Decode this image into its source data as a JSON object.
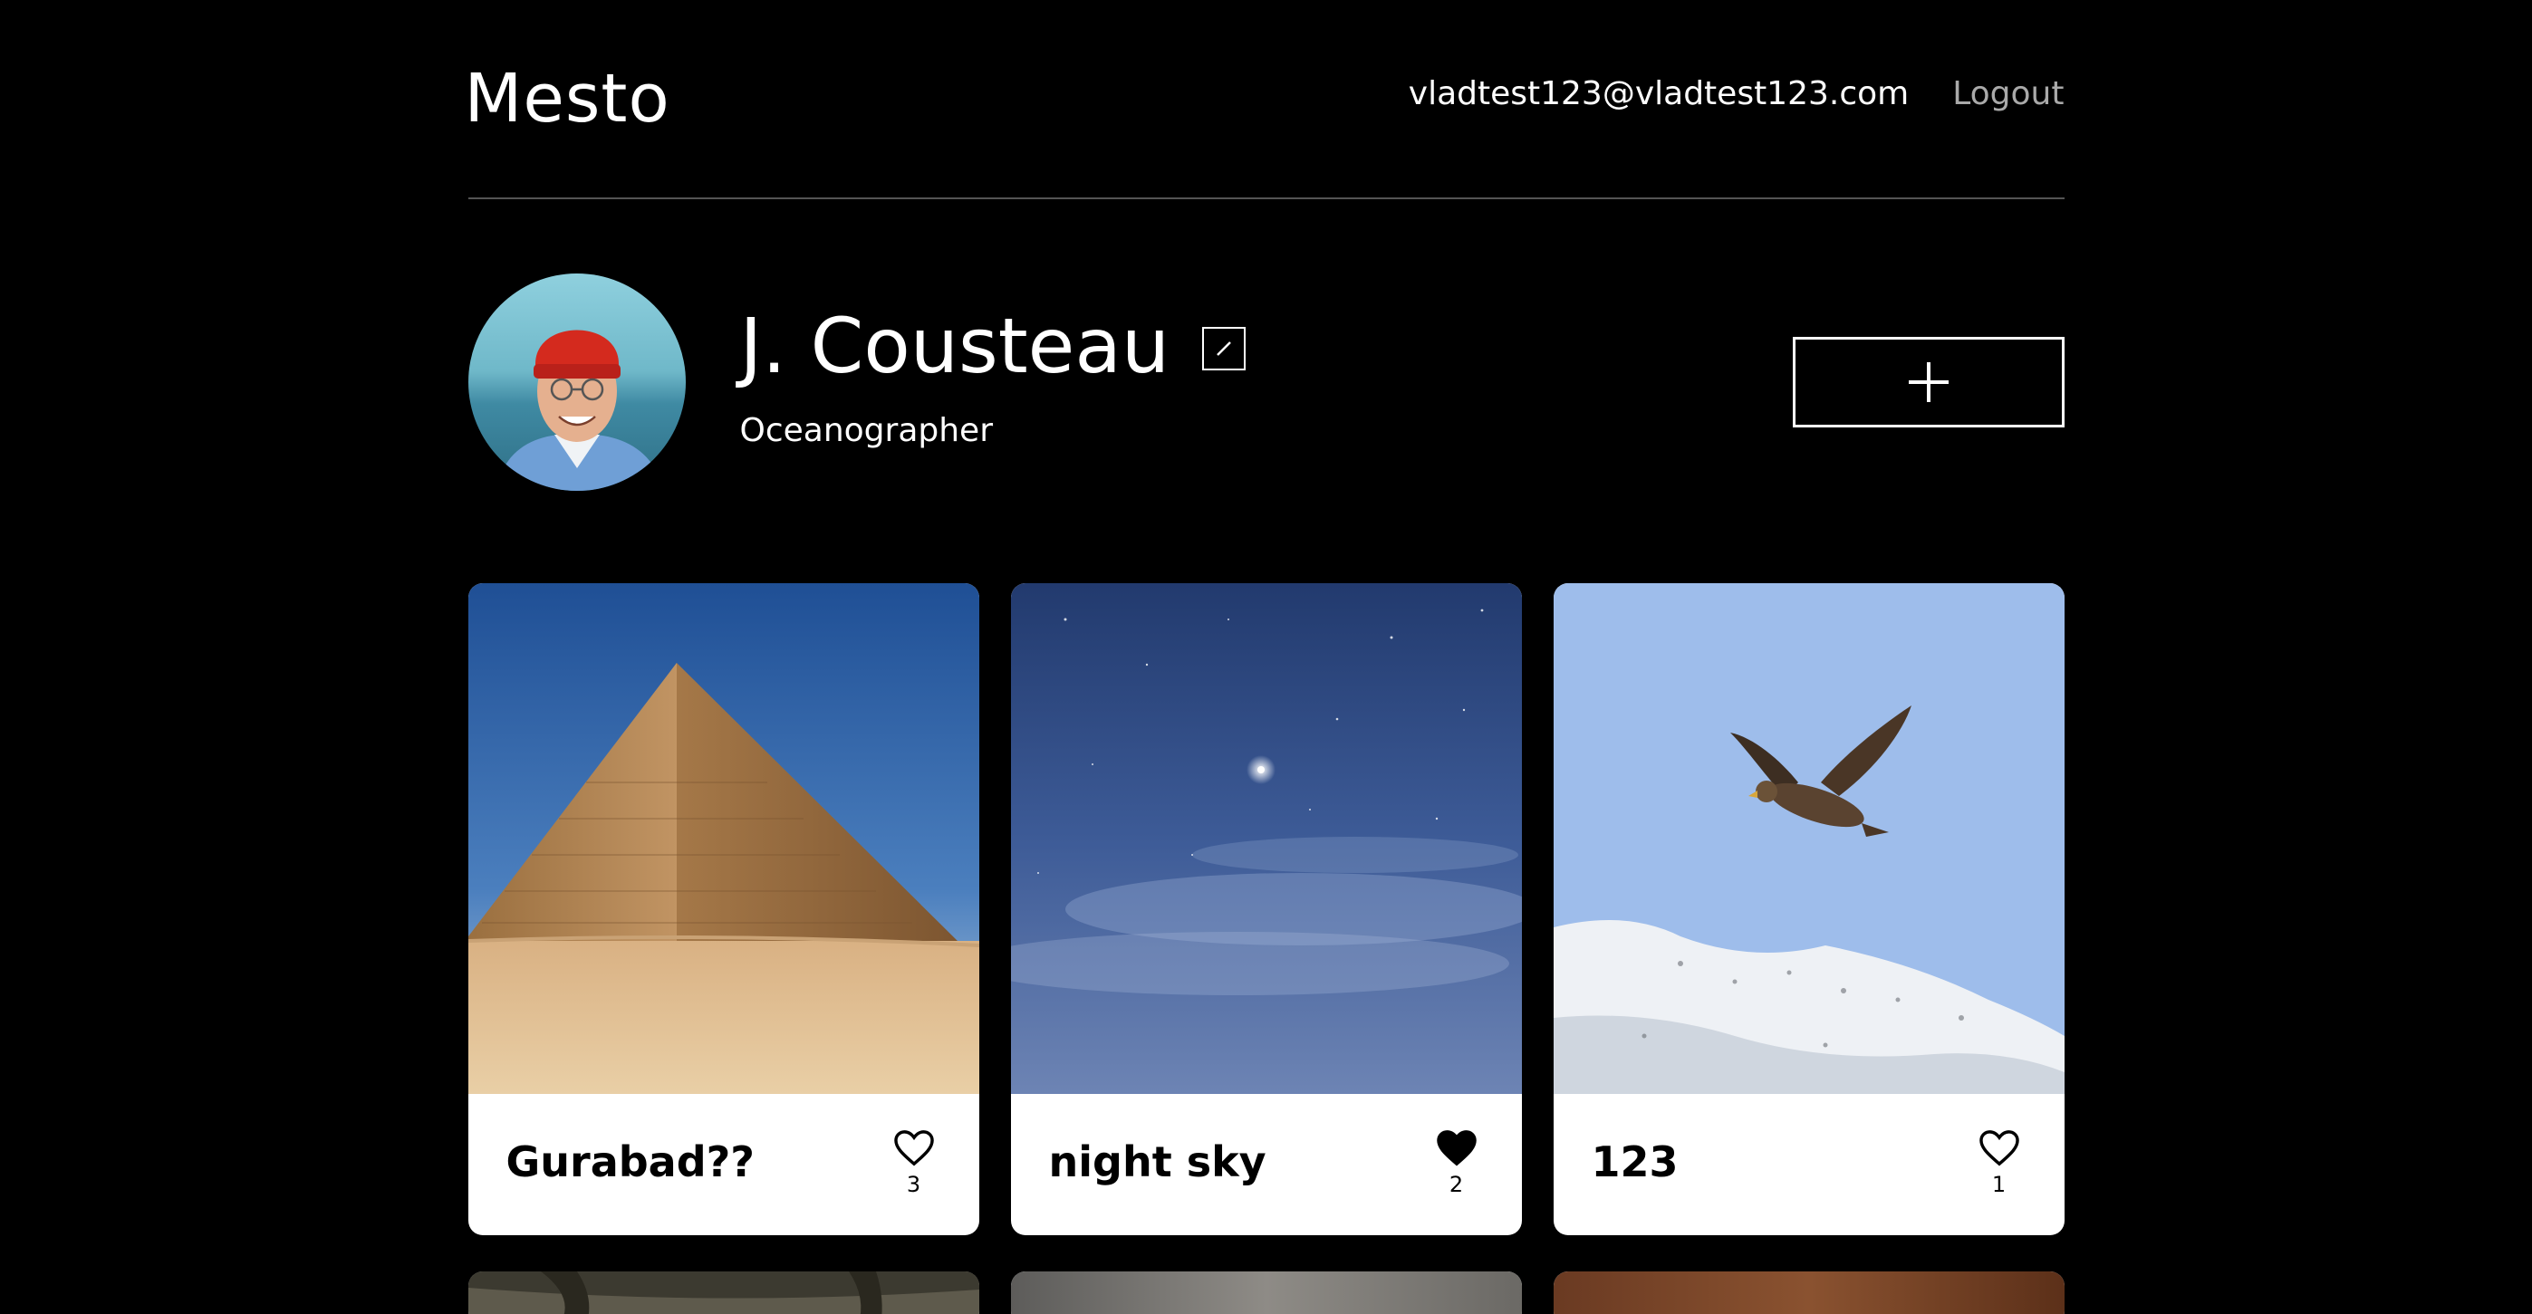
{
  "header": {
    "logo": "Mesto",
    "user_email": "vladtest123@vladtest123.com",
    "logout_label": "Logout"
  },
  "profile": {
    "name": "J. Cousteau",
    "about": "Oceanographer"
  },
  "icons": {
    "edit": "pencil-icon",
    "add": "plus-icon",
    "like": "heart-icon"
  },
  "cards": [
    {
      "title": "Gurabad??",
      "likes": "3",
      "liked": false,
      "image": "pyramid"
    },
    {
      "title": "night sky",
      "likes": "2",
      "liked": true,
      "image": "night-sky"
    },
    {
      "title": "123",
      "likes": "1",
      "liked": false,
      "image": "eagle"
    }
  ],
  "colors": {
    "background": "#000000",
    "text": "#ffffff",
    "muted": "#a9a9a9",
    "card": "#ffffff",
    "divider": "#545454"
  }
}
